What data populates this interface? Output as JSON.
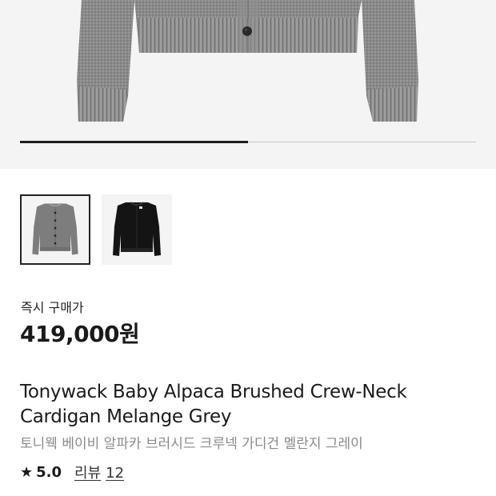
{
  "gallery": {
    "main_image": "grey-cardigan-photo",
    "progress": 0.5,
    "thumbnails": [
      {
        "image": "grey-cardigan-thumbnail",
        "color": "#7d7d7d",
        "selected": true
      },
      {
        "image": "black-cardigan-thumbnail",
        "color": "#141414",
        "selected": false
      }
    ]
  },
  "price": {
    "label": "즉시 구매가",
    "value": "419,000원"
  },
  "product": {
    "title_en_line1": "Tonywack Baby Alpaca Brushed Crew-Neck",
    "title_en_line2": "Cardigan Melange Grey",
    "title_ko": "토니웩 베이비 알파카 브러시드 크루넥 가디건 멜란지 그레이"
  },
  "rating": {
    "icon": "star-icon",
    "value": "5.0",
    "review_label": "리뷰",
    "review_count": "12"
  }
}
